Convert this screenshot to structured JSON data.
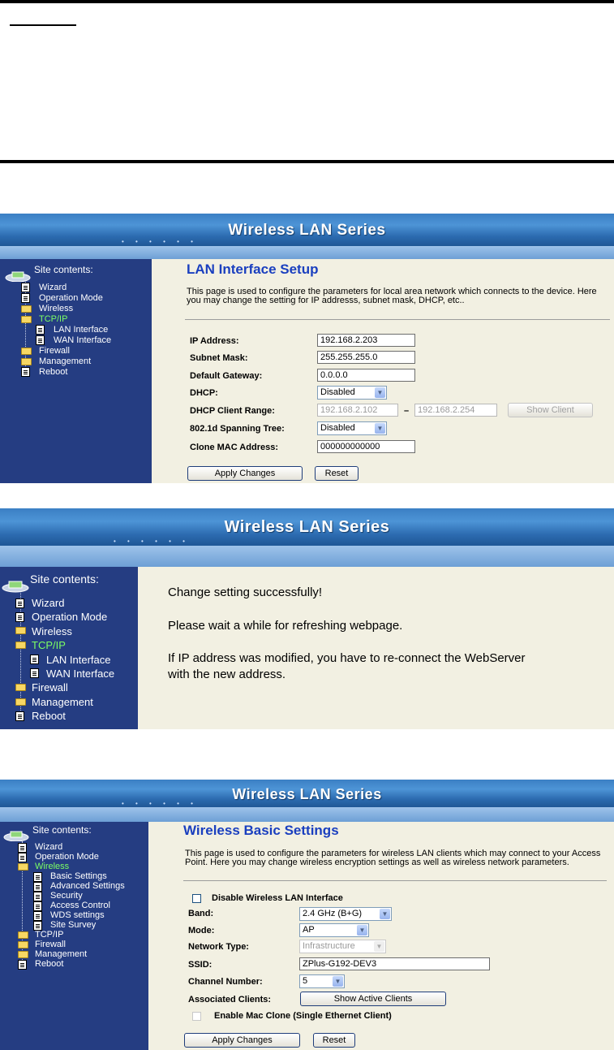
{
  "doc_header": {
    "underlined_text": ""
  },
  "screen1": {
    "banner_title": "Wireless LAN Series",
    "site_contents": "Site contents:",
    "nav": [
      "Wizard",
      "Operation Mode",
      "Wireless",
      "TCP/IP",
      "LAN Interface",
      "WAN Interface",
      "Firewall",
      "Management",
      "Reboot"
    ],
    "active_nav": "TCP/IP",
    "page_title": "LAN Interface Setup",
    "description": "This page is used to configure the parameters for local area network which connects to the device. Here you may change the setting for IP addresss, subnet mask, DHCP, etc..",
    "labels": {
      "ip": "IP Address:",
      "subnet": "Subnet Mask:",
      "gateway": "Default Gateway:",
      "dhcp": "DHCP:",
      "dhcp_range": "DHCP Client Range:",
      "stp": "802.1d Spanning Tree:",
      "clone_mac": "Clone MAC Address:"
    },
    "values": {
      "ip": "192.168.2.203",
      "subnet": "255.255.255.0",
      "gateway": "0.0.0.0",
      "dhcp": "Disabled",
      "range_start": "192.168.2.102",
      "range_sep": "–",
      "range_end": "192.168.2.254",
      "stp": "Disabled",
      "clone_mac": "000000000000"
    },
    "buttons": {
      "show_client": "Show Client",
      "apply": "Apply Changes",
      "reset": "Reset"
    }
  },
  "screen2": {
    "banner_title": "Wireless LAN Series",
    "site_contents": "Site contents:",
    "nav": [
      "Wizard",
      "Operation Mode",
      "Wireless",
      "TCP/IP",
      "LAN Interface",
      "WAN Interface",
      "Firewall",
      "Management",
      "Reboot"
    ],
    "active_nav": "TCP/IP",
    "messages": {
      "line1": "Change setting successfully!",
      "line2": "Please wait a while for refreshing webpage.",
      "line3a": "If IP address was modified, you have to re-connect the WebServer",
      "line3b": "with the new address."
    }
  },
  "screen3": {
    "banner_title": "Wireless LAN Series",
    "site_contents": "Site contents:",
    "nav": [
      "Wizard",
      "Operation Mode",
      "Wireless",
      "Basic Settings",
      "Advanced Settings",
      "Security",
      "Access Control",
      "WDS settings",
      "Site Survey",
      "TCP/IP",
      "Firewall",
      "Management",
      "Reboot"
    ],
    "active_nav": "Wireless",
    "page_title": "Wireless Basic Settings",
    "description": "This page is used to configure the parameters for wireless LAN clients which may connect to your Access Point. Here you may change wireless encryption settings as well as wireless network parameters.",
    "labels": {
      "disable_wlan": "Disable Wireless LAN Interface",
      "band": "Band:",
      "mode": "Mode:",
      "network_type": "Network Type:",
      "ssid": "SSID:",
      "channel": "Channel Number:",
      "assoc": "Associated Clients:",
      "mac_clone": "Enable Mac Clone (Single Ethernet Client)"
    },
    "values": {
      "band": "2.4 GHz (B+G)",
      "mode": "AP",
      "network_type": "Infrastructure",
      "ssid": "ZPlus-G192-DEV3",
      "channel": "5"
    },
    "buttons": {
      "show_active": "Show Active Clients",
      "apply": "Apply Changes",
      "reset": "Reset"
    }
  }
}
